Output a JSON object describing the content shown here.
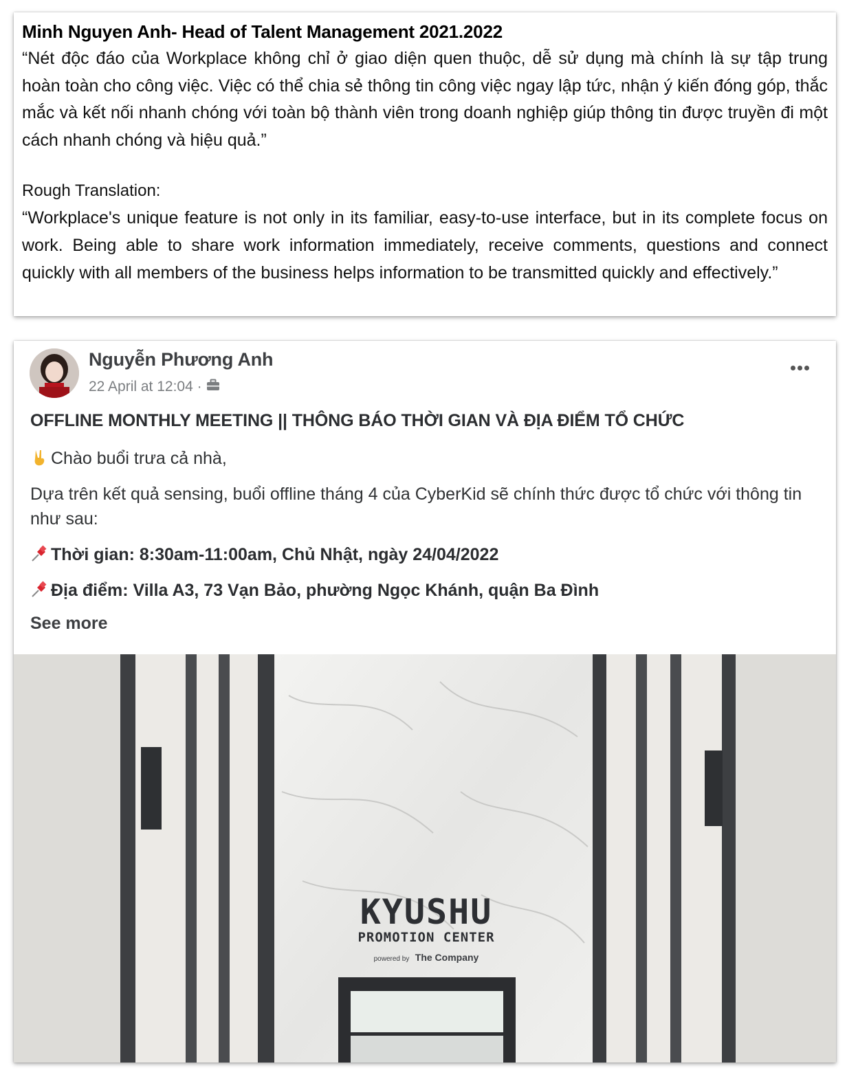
{
  "quote": {
    "title": "Minh Nguyen Anh- Head of Talent Management 2021.2022",
    "original": "“Nét độc đáo của Workplace không chỉ ở giao diện quen thuộc, dễ sử dụng mà chính là sự tập trung hoàn toàn cho công việc. Việc có thể chia sẻ thông tin công việc ngay lập tức, nhận ý kiến đóng góp, thắc mắc và kết nối nhanh chóng với toàn bộ thành viên trong doanh nghiệp giúp thông tin được truyền đi một cách nhanh chóng và hiệu quả.”",
    "translation_label": "Rough Translation:",
    "translation": "“Workplace's unique feature is not only in its familiar, easy-to-use interface, but in its complete focus on work. Being able to share work information immediately, receive comments, questions and connect quickly with all members of the business helps information to be transmitted quickly and effectively.”"
  },
  "post": {
    "author": "Nguyễn Phương Anh",
    "timestamp": "22 April at 12:04 ·",
    "audience_icon": "briefcase-icon",
    "more_icon": "more-options-icon",
    "headline": "OFFLINE MONTHLY MEETING || THÔNG BÁO THỜI GIAN VÀ ĐỊA ĐIỂM TỔ CHỨC",
    "greeting": "Chào buổi trưa cả nhà,",
    "intro": "Dựa trên kết quả sensing, buổi offline tháng 4 của CyberKid sẽ chính thức được tổ chức với thông tin như sau:",
    "time": "Thời gian: 8:30am-11:00am, Chủ Nhật, ngày 24/04/2022",
    "location": "Địa điểm: Villa A3, 73 Vạn Bảo, phường Ngọc Khánh, quận Ba Đình",
    "see_more": "See more",
    "photo": {
      "sign_main": "KYUSHU",
      "sign_sub": "PROMOTION CENTER",
      "sign_powered": "powered by",
      "sign_company": "The Company"
    }
  }
}
